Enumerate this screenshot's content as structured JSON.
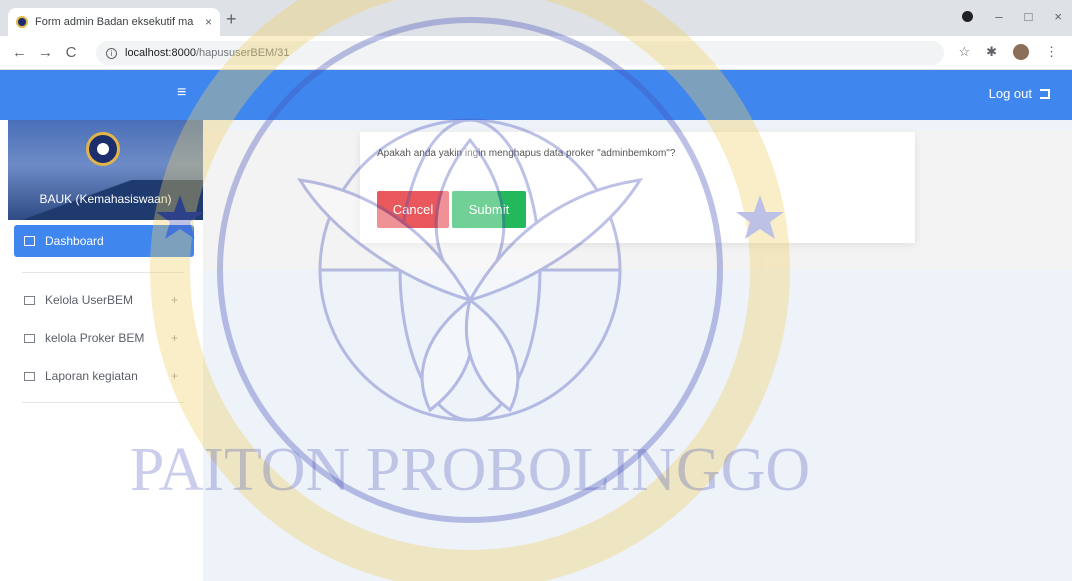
{
  "browser": {
    "tab_title": "Form admin Badan eksekutif ma",
    "tab_close": "×",
    "new_tab": "+",
    "url_host": "localhost:8000",
    "url_path": "/hapususerBEM/31",
    "win_minimize": "–",
    "win_restore": "□",
    "win_close": "×",
    "back": "←",
    "forward": "→",
    "reload": "C",
    "star": "☆",
    "extensions": "✱",
    "menu": "⋮"
  },
  "header": {
    "menu_icon": "≡",
    "logout_label": "Log out"
  },
  "sidebar": {
    "brand_name": "BAUK (Kemahasiswaan)",
    "active_item": "Dashboard",
    "items": [
      {
        "label": "Kelola UserBEM",
        "expand": "+"
      },
      {
        "label": "kelola Proker BEM",
        "expand": "+"
      },
      {
        "label": "Laporan kegiatan",
        "expand": "+"
      }
    ]
  },
  "dialog": {
    "message": "Apakah anda yakin ingin menghapus data proker \"adminbemkom\"?",
    "cancel_label": "Cancel",
    "submit_label": "Submit"
  },
  "watermark": {
    "text": "PAITON PROBOLINGGO"
  },
  "colors": {
    "header": "#3f86ee",
    "cancel": "#e8585c",
    "submit": "#23b85c",
    "watermark_blue": "#4650b8",
    "watermark_gold": "#f0d060"
  }
}
